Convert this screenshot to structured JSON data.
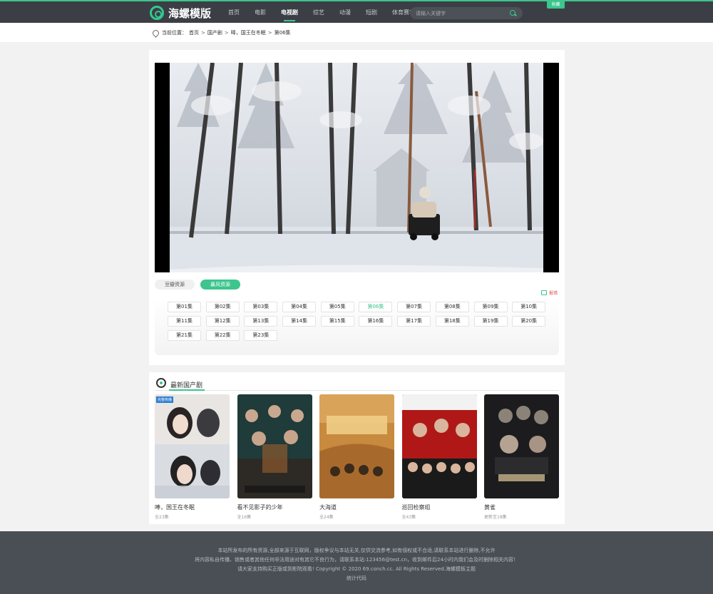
{
  "header": {
    "logo_text": "海螺模版",
    "nav": [
      "首页",
      "电影",
      "电视剧",
      "综艺",
      "动漫",
      "短剧",
      "体育赛事"
    ],
    "active_nav": "电视剧",
    "search_placeholder": "请输入关键字",
    "fav_label": "收藏"
  },
  "breadcrumb": {
    "prefix": "当前位置：",
    "items": [
      "首页",
      "国产剧",
      "唪，国王在冬眠",
      "第06集"
    ],
    "separator": ">"
  },
  "player": {
    "sources": [
      "豆瓣资源",
      "暴风资源"
    ],
    "active_source": "暴风资源",
    "report_label": "报错",
    "episodes": [
      "第01集",
      "第02集",
      "第03集",
      "第04集",
      "第05集",
      "第06集",
      "第07集",
      "第08集",
      "第09集",
      "第10集",
      "第11集",
      "第12集",
      "第13集",
      "第14集",
      "第15集",
      "第16集",
      "第17集",
      "第18集",
      "第19集",
      "第20集",
      "第21集",
      "第22集",
      "第23集"
    ],
    "active_episode": "第06集"
  },
  "latest": {
    "title": "最新国产剧",
    "items": [
      {
        "title": "唪，国王在冬眠",
        "sub": "全23集",
        "tag": "完整热播"
      },
      {
        "title": "看不见影子的少年",
        "sub": "全16集",
        "tag": ""
      },
      {
        "title": "大海道",
        "sub": "全24集",
        "tag": ""
      },
      {
        "title": "巡回检察组",
        "sub": "全43集",
        "tag": ""
      },
      {
        "title": "黄雀",
        "sub": "更新至18集",
        "tag": ""
      }
    ]
  },
  "footer": {
    "lines": [
      "本站所发布的所有资源,全部来源于互联网，版权争议与本站无关,仅供交流参考,如有侵权或不合适,请联系本站进行删除,不允许",
      "将内容私自传播、销售或者其他任何非法用途对有其它不良行为，请联系本站:123456@test.cn，收到邮件后24小时内我们会及时删除相关内容！",
      "请大家支持购买正版或到影院观看! Copyright © 2020 69.conch.cc. All Rights Reserved.海螺模板主题",
      "统计代码"
    ]
  },
  "colors": {
    "accent": "#3cc58d",
    "header_bg": "#3b3f45",
    "footer_bg": "#4a4f56"
  }
}
